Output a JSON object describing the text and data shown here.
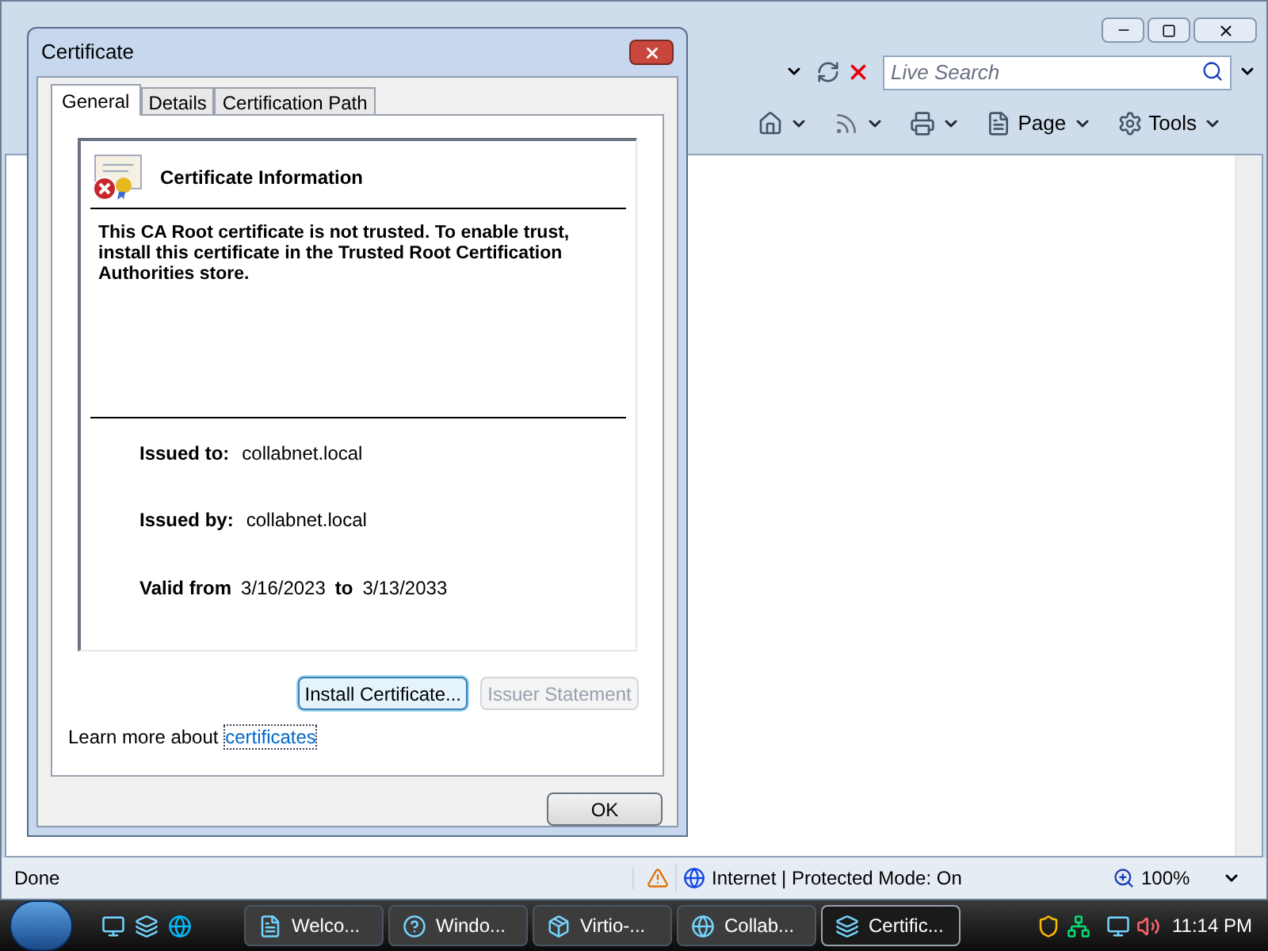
{
  "browser": {
    "search": {
      "placeholder": "Live Search"
    },
    "command_bar": [
      {
        "kind": "home"
      },
      {
        "kind": "feeds"
      },
      {
        "kind": "print"
      },
      {
        "kind": "page",
        "label": "Page"
      },
      {
        "kind": "tools",
        "label": "Tools"
      }
    ],
    "status_bar": {
      "status": "Done",
      "zone": "Internet | Protected Mode: On",
      "zoom": "100%"
    }
  },
  "dialog": {
    "title": "Certificate",
    "tabs": [
      {
        "label": "General",
        "selected": true
      },
      {
        "label": "Details",
        "selected": false
      },
      {
        "label": "Certification Path",
        "selected": false
      }
    ],
    "info_title": "Certificate Information",
    "message": "This CA Root certificate is not trusted. To enable trust, install this certificate in the Trusted Root Certification Authorities store.",
    "fields": [
      {
        "label": "Issued to:",
        "value": "collabnet.local"
      },
      {
        "label": "Issued by:",
        "value": "collabnet.local"
      }
    ],
    "validity": {
      "label": "Valid from",
      "from": "3/16/2023",
      "to_label": "to",
      "to": "3/13/2033"
    },
    "buttons": [
      {
        "label": "Install Certificate...",
        "disabled": false,
        "focused": true
      },
      {
        "label": "Issuer Statement",
        "disabled": true,
        "focused": false
      }
    ],
    "learn_more": {
      "text": "Learn more about",
      "link": "certificates"
    },
    "ok": "OK"
  },
  "taskbar": {
    "tasks": [
      {
        "label": "Welco...",
        "kind": "doc",
        "selected": false
      },
      {
        "label": "Windo...",
        "kind": "help",
        "selected": false
      },
      {
        "label": "Virtio-...",
        "kind": "setup",
        "selected": false
      },
      {
        "label": "Collab...",
        "kind": "ie",
        "selected": false
      },
      {
        "label": "Certific...",
        "kind": "cert",
        "selected": true
      }
    ],
    "clock": "11:14 PM"
  }
}
